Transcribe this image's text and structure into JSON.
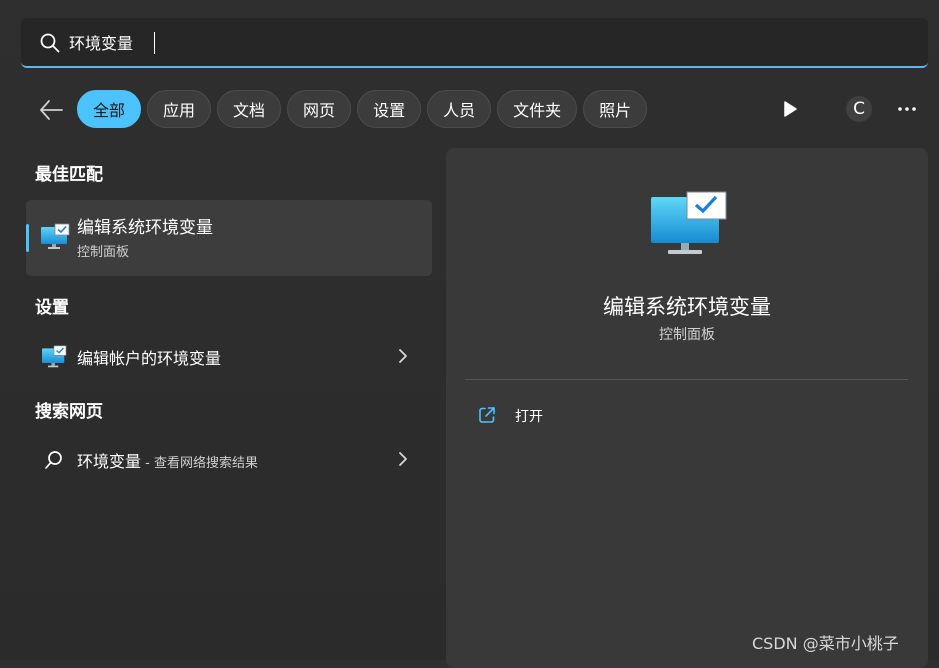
{
  "search": {
    "value": "环境变量",
    "placeholder": ""
  },
  "tabs": [
    {
      "label": "全部",
      "active": true
    },
    {
      "label": "应用"
    },
    {
      "label": "文档"
    },
    {
      "label": "网页"
    },
    {
      "label": "设置"
    },
    {
      "label": "人员"
    },
    {
      "label": "文件夹"
    },
    {
      "label": "照片"
    }
  ],
  "header": {
    "avatar_letter": "C"
  },
  "sections": {
    "best_match": "最佳匹配",
    "settings": "设置",
    "web": "搜索网页"
  },
  "best_match": {
    "title": "编辑系统环境变量",
    "subtitle": "控制面板"
  },
  "settings_item": {
    "title": "编辑帐户的环境变量"
  },
  "web_item": {
    "query": "环境变量",
    "suffix": " - 查看网络搜索结果"
  },
  "detail": {
    "title": "编辑系统环境变量",
    "subtitle": "控制面板",
    "open_label": "打开"
  },
  "watermark": "CSDN @菜市小桃子",
  "icons": {
    "search": "search-icon",
    "back": "back-arrow-icon",
    "play": "play-icon",
    "more": "more-icon",
    "chevron": "chevron-right-icon",
    "control_panel": "monitor-check-icon",
    "open": "open-external-icon"
  },
  "colors": {
    "accent": "#4cc2ff",
    "background": "#2d2d2d",
    "panel": "#393939"
  }
}
